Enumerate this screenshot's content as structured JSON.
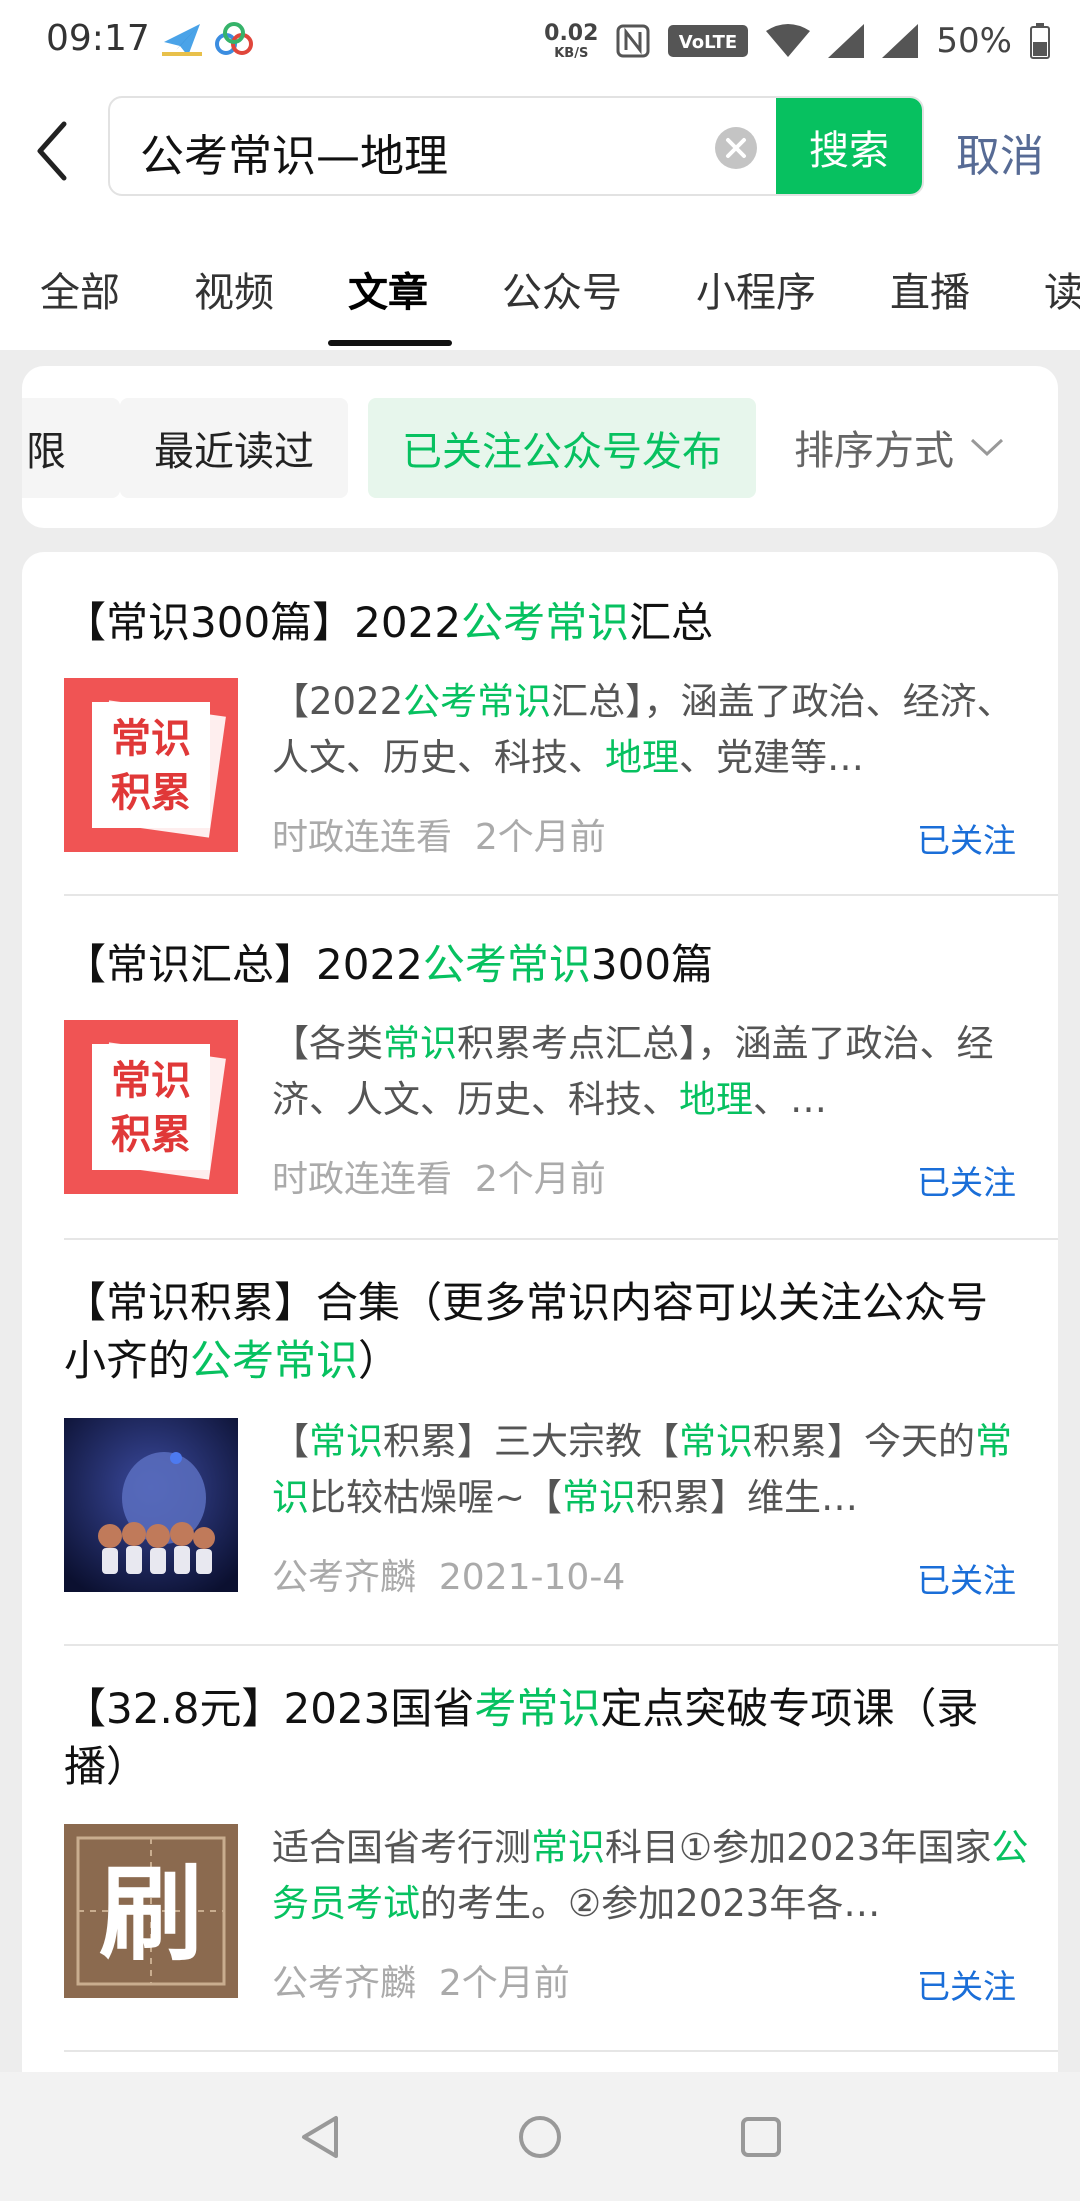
{
  "status_bar": {
    "time": "09:17",
    "net_speed_value": "0.02",
    "net_speed_unit": "KB/S",
    "nfc_icon": "N",
    "volte": "VoLTE",
    "battery": "50%"
  },
  "search": {
    "query": "公考常识—地理",
    "button_label": "搜索",
    "cancel_label": "取消"
  },
  "tabs": [
    {
      "label": "全部"
    },
    {
      "label": "视频"
    },
    {
      "label": "文章",
      "active": true
    },
    {
      "label": "公众号"
    },
    {
      "label": "小程序"
    },
    {
      "label": "直播"
    },
    {
      "label": "读"
    }
  ],
  "filters": {
    "chips": [
      {
        "label": "限"
      },
      {
        "label": "最近读过"
      },
      {
        "label": "已关注公众号发布",
        "active": true
      }
    ],
    "sort_label": "排序方式"
  },
  "results": [
    {
      "title_parts": [
        {
          "t": "【常识300篇】2022",
          "hl": false
        },
        {
          "t": "公考常识",
          "hl": true
        },
        {
          "t": "汇总",
          "hl": false
        }
      ],
      "thumb_text": [
        "常识",
        "积累"
      ],
      "snippet_parts": [
        {
          "t": "【2022",
          "hl": false
        },
        {
          "t": "公考常识",
          "hl": true
        },
        {
          "t": "汇总】，涵盖了政治、经济、人文、历史、科技、",
          "hl": false
        },
        {
          "t": "地理",
          "hl": true
        },
        {
          "t": "、党建等…",
          "hl": false
        }
      ],
      "source": "时政连连看",
      "time": "2个月前",
      "follow": "已关注"
    },
    {
      "title_parts": [
        {
          "t": "【常识汇总】2022",
          "hl": false
        },
        {
          "t": "公考常识",
          "hl": true
        },
        {
          "t": "300篇",
          "hl": false
        }
      ],
      "thumb_text": [
        "常识",
        "积累"
      ],
      "snippet_parts": [
        {
          "t": "【各类",
          "hl": false
        },
        {
          "t": "常识",
          "hl": true
        },
        {
          "t": "积累考点汇总】，涵盖了政治、经济、人文、历史、科技、",
          "hl": false
        },
        {
          "t": "地理",
          "hl": true
        },
        {
          "t": "、…",
          "hl": false
        }
      ],
      "source": "时政连连看",
      "time": "2个月前",
      "follow": "已关注"
    },
    {
      "title_parts": [
        {
          "t": "【常识积累】合集（更多常识内容可以关注公众号小齐的",
          "hl": false
        },
        {
          "t": "公考常识",
          "hl": true
        },
        {
          "t": "）",
          "hl": false
        }
      ],
      "snippet_parts": [
        {
          "t": "【",
          "hl": false
        },
        {
          "t": "常识",
          "hl": true
        },
        {
          "t": "积累】三大宗教【",
          "hl": false
        },
        {
          "t": "常识",
          "hl": true
        },
        {
          "t": "积累】今天的",
          "hl": false
        },
        {
          "t": "常识",
          "hl": true
        },
        {
          "t": "比较枯燥喔~【",
          "hl": false
        },
        {
          "t": "常识",
          "hl": true
        },
        {
          "t": "积累】维生…",
          "hl": false
        }
      ],
      "source": "公考齐麟",
      "time": "2021-10-4",
      "follow": "已关注"
    },
    {
      "title_parts": [
        {
          "t": "【32.8元】2023国省",
          "hl": false
        },
        {
          "t": "考常识",
          "hl": true
        },
        {
          "t": "定点突破专项课（录播）",
          "hl": false
        }
      ],
      "thumb_text": [
        "刷"
      ],
      "snippet_parts": [
        {
          "t": "适合国省考行测",
          "hl": false
        },
        {
          "t": "常识",
          "hl": true
        },
        {
          "t": "科目①参加2023年国家",
          "hl": false
        },
        {
          "t": "公务员考试",
          "hl": true
        },
        {
          "t": "的考生。②参加2023年各…",
          "hl": false
        }
      ],
      "source": "公考齐麟",
      "time": "2个月前",
      "follow": "已关注"
    }
  ],
  "colors": {
    "accent_green": "#07c160",
    "link_blue": "#1a6ed8",
    "cancel_blue": "#576b95",
    "thumb_red": "#f05454",
    "thumb_brown": "#8b6a4f"
  },
  "icons": [
    "back-arrow-icon",
    "clear-icon",
    "chevron-down-icon",
    "nav-back-icon",
    "nav-home-icon",
    "nav-recents-icon",
    "wifi-icon",
    "signal-icon",
    "battery-icon"
  ]
}
